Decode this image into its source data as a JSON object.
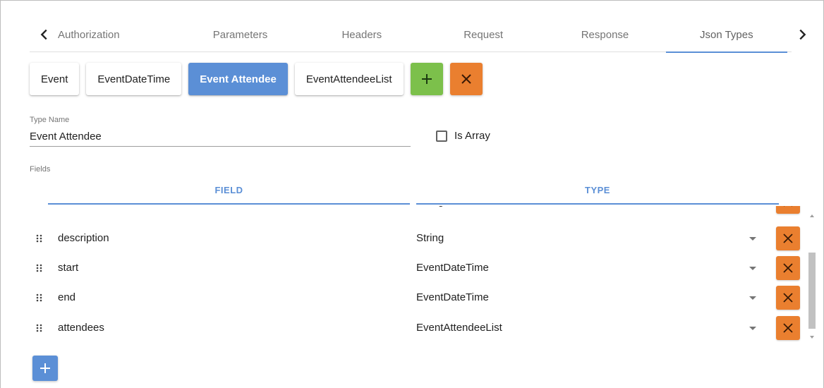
{
  "tabs": [
    {
      "label": "Authorization",
      "active": false
    },
    {
      "label": "Parameters",
      "active": false
    },
    {
      "label": "Headers",
      "active": false
    },
    {
      "label": "Request",
      "active": false
    },
    {
      "label": "Response",
      "active": false
    },
    {
      "label": "Json Types",
      "active": true
    }
  ],
  "types": [
    {
      "label": "Event",
      "active": false
    },
    {
      "label": "EventDateTime",
      "active": false
    },
    {
      "label": "Event Attendee",
      "active": true
    },
    {
      "label": "EventAttendeeList",
      "active": false
    }
  ],
  "type_name": {
    "label": "Type Name",
    "value": "Event Attendee"
  },
  "is_array": {
    "label": "Is Array",
    "checked": false
  },
  "fields": {
    "label": "Fields",
    "header_field": "FIELD",
    "header_type": "TYPE",
    "rows": [
      {
        "name": "",
        "type": "String"
      },
      {
        "name": "description",
        "type": "String"
      },
      {
        "name": "start",
        "type": "EventDateTime"
      },
      {
        "name": "end",
        "type": "EventDateTime"
      },
      {
        "name": "attendees",
        "type": "EventAttendeeList"
      }
    ]
  },
  "colors": {
    "accent_blue": "#5b8fd6",
    "add_green": "#7cc04b",
    "delete_orange": "#ea7f2f"
  },
  "icons": {
    "prev": "chevron-left-icon",
    "next": "chevron-right-icon",
    "add": "plus-icon",
    "delete": "close-icon",
    "drag": "drag-handle-icon"
  }
}
